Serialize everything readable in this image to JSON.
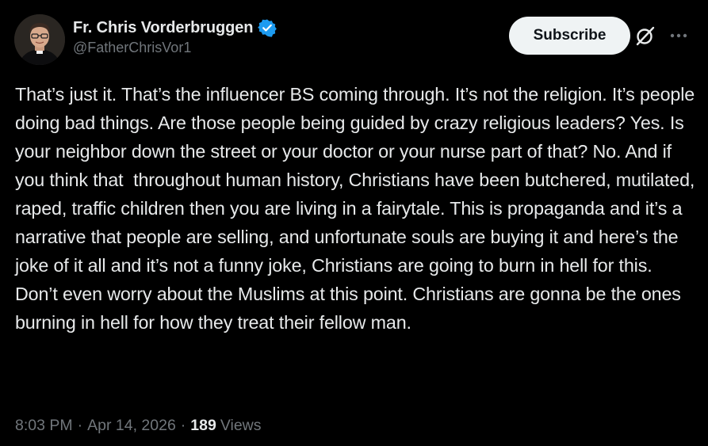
{
  "author": {
    "display_name": "Fr. Chris Vorderbruggen",
    "handle": "@FatherChrisVor1",
    "verified_icon": "verified-badge-icon",
    "verified_color": "#1d9bf0"
  },
  "actions": {
    "subscribe_label": "Subscribe",
    "grok_icon": "grok-icon",
    "more_icon": "more-options-icon"
  },
  "tweet": {
    "text": "That’s just it. That’s the influencer BS coming through. It’s not the religion. It’s people doing bad things. Are those people being guided by crazy religious leaders? Yes. Is your neighbor down the street or your doctor or your nurse part of that? No. And if you think that  throughout human history, Christians have been butchered, mutilated, raped, traffic children then you are living in a fairytale. This is propaganda and it’s a narrative that people are selling, and unfortunate souls are buying it and here’s the joke of it all and it’s not a funny joke, Christians are going to burn in hell for this. Don’t even worry about the Muslims at this point. Christians are gonna be the ones burning in hell for how they treat their fellow man."
  },
  "meta": {
    "time": "8:03 PM",
    "separator": "·",
    "date": "Apr 14, 2026",
    "views_count": "189",
    "views_label": "Views"
  },
  "colors": {
    "background": "#000000",
    "text_primary": "#e7e9ea",
    "text_secondary": "#71767b",
    "button_bg": "#eff3f4",
    "button_text": "#0f1419"
  }
}
